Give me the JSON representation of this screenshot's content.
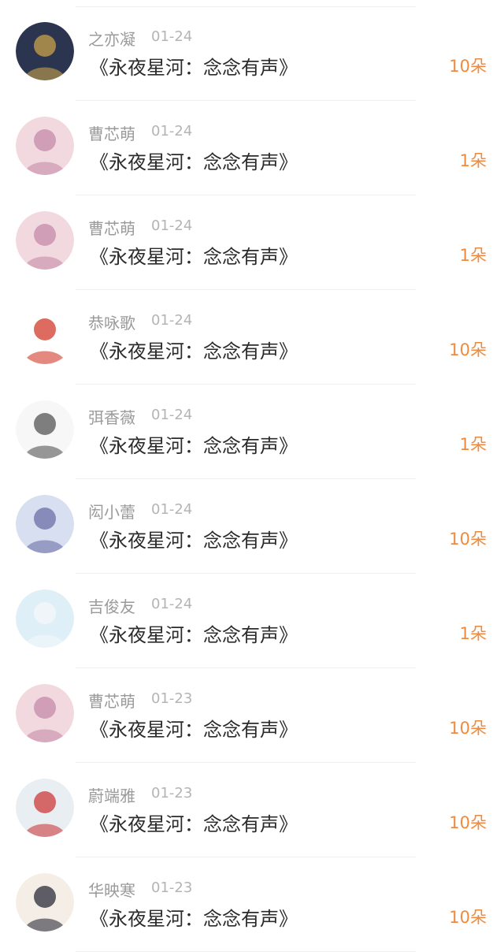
{
  "records": [
    {
      "name": "之亦凝",
      "date": "01-24",
      "title": "《永夜星河：念念有声》",
      "amount": "10朵",
      "avatar_icon": "armored-warrior-avatar-icon",
      "avatar_colors": [
        "#2b3550",
        "#c8a24a"
      ]
    },
    {
      "name": "曹芯萌",
      "date": "01-24",
      "title": "《永夜星河：念念有声》",
      "amount": "1朵",
      "avatar_icon": "anime-girl-avatar-icon",
      "avatar_colors": [
        "#f2d9df",
        "#c48aa8"
      ]
    },
    {
      "name": "曹芯萌",
      "date": "01-24",
      "title": "《永夜星河：念念有声》",
      "amount": "1朵",
      "avatar_icon": "anime-girl-avatar-icon",
      "avatar_colors": [
        "#f2d9df",
        "#c48aa8"
      ]
    },
    {
      "name": "恭咏歌",
      "date": "01-24",
      "title": "《永夜星河：念念有声》",
      "amount": "10朵",
      "avatar_icon": "cartoon-meme-avatar-icon",
      "avatar_colors": [
        "#ffffff",
        "#d23a2a"
      ]
    },
    {
      "name": "弭香薇",
      "date": "01-24",
      "title": "《永夜星河：念念有声》",
      "amount": "1朵",
      "avatar_icon": "sketch-boy-avatar-icon",
      "avatar_colors": [
        "#f7f7f7",
        "#555555"
      ]
    },
    {
      "name": "闳小蕾",
      "date": "01-24",
      "title": "《永夜星河：念念有声》",
      "amount": "10朵",
      "avatar_icon": "winter-girl-avatar-icon",
      "avatar_colors": [
        "#d7dff0",
        "#6c6fa8"
      ]
    },
    {
      "name": "吉俊友",
      "date": "01-24",
      "title": "《永夜星河：念念有声》",
      "amount": "1朵",
      "avatar_icon": "masked-person-avatar-icon",
      "avatar_colors": [
        "#dfeff7",
        "#f4f7f9"
      ]
    },
    {
      "name": "曹芯萌",
      "date": "01-23",
      "title": "《永夜星河：念念有声》",
      "amount": "10朵",
      "avatar_icon": "anime-girl-avatar-icon",
      "avatar_colors": [
        "#f2d9df",
        "#c48aa8"
      ]
    },
    {
      "name": "蔚端雅",
      "date": "01-23",
      "title": "《永夜星河：念念有声》",
      "amount": "10朵",
      "avatar_icon": "child-photo-avatar-icon",
      "avatar_colors": [
        "#e9eef3",
        "#cc3b3b"
      ]
    },
    {
      "name": "华映寒",
      "date": "01-23",
      "title": "《永夜星河：念念有声》",
      "amount": "10朵",
      "avatar_icon": "dark-hair-girl-avatar-icon",
      "avatar_colors": [
        "#f4eee6",
        "#2c2c3a"
      ]
    }
  ],
  "colors": {
    "name": "#9a9a9a",
    "date": "#b4b4b4",
    "title": "#2b2b2b",
    "amount": "#ef8a3c",
    "divider": "#f0f0f0"
  }
}
